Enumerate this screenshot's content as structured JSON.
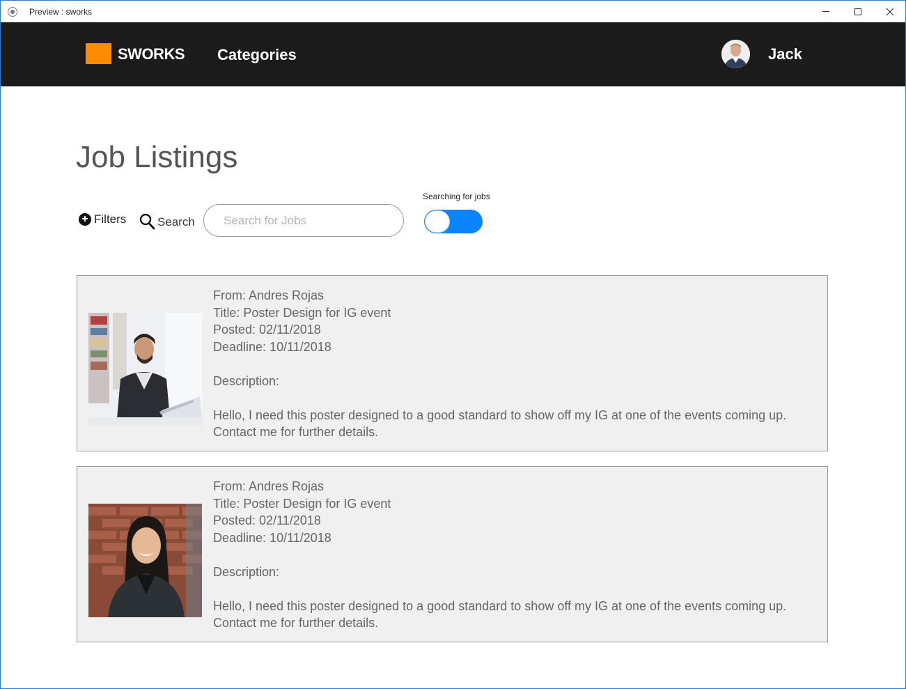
{
  "window": {
    "title": "Preview : sworks"
  },
  "nav": {
    "brand": "SWORKS",
    "categories_label": "Categories",
    "username": "Jack"
  },
  "page": {
    "title": "Job Listings"
  },
  "toolbar": {
    "filters_label": "Filters",
    "search_label": "Search",
    "search_placeholder": "Search for Jobs",
    "toggle_label": "Searching for jobs",
    "toggle_on": true
  },
  "colors": {
    "accent": "#ff8c00",
    "toggle": "#0a84ff",
    "navbar": "#1b1b1b"
  },
  "listings": [
    {
      "from": "From: Andres Rojas",
      "title": "Title: Poster Design for IG event",
      "posted": "Posted: 02/11/2018",
      "deadline": "Deadline: 10/11/2018",
      "description_label": "Description:",
      "description_line1": "Hello, I need this poster designed to a good standard to show off my IG at one of the events coming up.",
      "description_line2": "Contact me for further details."
    },
    {
      "from": "From: Andres Rojas",
      "title": "Title: Poster Design for IG event",
      "posted": "Posted: 02/11/2018",
      "deadline": "Deadline: 10/11/2018",
      "description_label": "Description:",
      "description_line1": "Hello, I need this poster designed to a good standard to show off my IG at one of the events coming up.",
      "description_line2": "Contact me for further details."
    }
  ]
}
